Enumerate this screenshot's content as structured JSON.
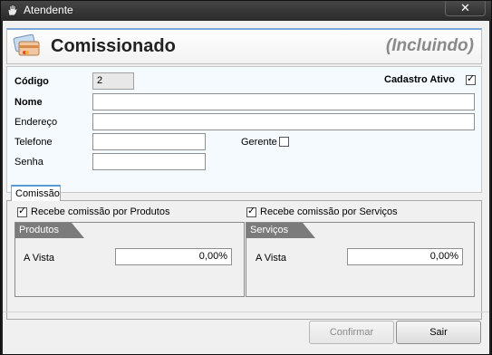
{
  "window": {
    "title": "Atendente",
    "close_label": "✕"
  },
  "header": {
    "form_title": "Comissionado",
    "mode": "(Incluindo)"
  },
  "fields": {
    "codigo": {
      "label": "Código",
      "value": "2"
    },
    "cadastro_ativo": {
      "label": "Cadastro Ativo",
      "checked": true
    },
    "nome": {
      "label": "Nome",
      "value": ""
    },
    "endereco": {
      "label": "Endereço",
      "value": ""
    },
    "telefone": {
      "label": "Telefone",
      "value": ""
    },
    "gerente": {
      "label": "Gerente",
      "checked": false
    },
    "senha": {
      "label": "Senha",
      "value": ""
    }
  },
  "tabs": [
    {
      "label": "Comissão",
      "active": true
    }
  ],
  "commission": {
    "produtos_check_label": "Recebe comissão por Produtos",
    "servicos_check_label": "Recebe comissão por Serviços",
    "produtos": {
      "title": "Produtos",
      "avista_label": "A Vista",
      "avista_value": "0,00%"
    },
    "servicos": {
      "title": "Serviços",
      "avista_label": "A Vista",
      "avista_value": "0,00%"
    }
  },
  "buttons": {
    "confirmar": "Confirmar",
    "sair": "Sair"
  },
  "check_glyph": "✓"
}
